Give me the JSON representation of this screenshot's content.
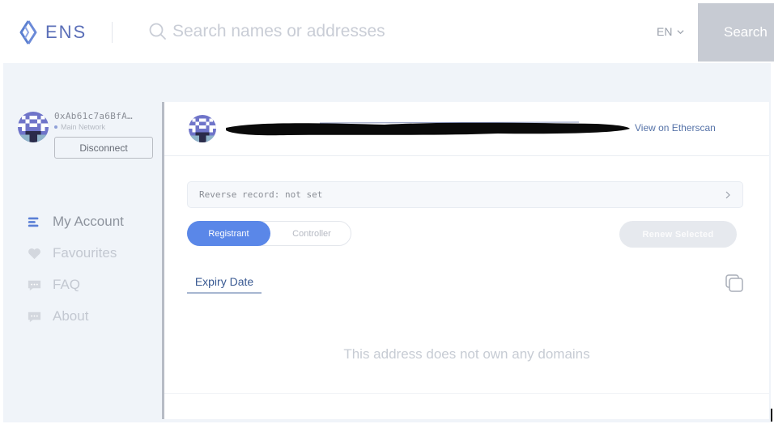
{
  "header": {
    "logo_text": "ENS",
    "search_placeholder": "Search names or addresses",
    "language": "EN",
    "search_button": "Search"
  },
  "account": {
    "address": "0xAb61c7a6BfA…",
    "network": "Main Network",
    "disconnect_label": "Disconnect"
  },
  "sidebar": {
    "items": [
      {
        "label": "My Account",
        "icon": "list-icon",
        "active": true
      },
      {
        "label": "Favourites",
        "icon": "heart-icon",
        "active": false
      },
      {
        "label": "FAQ",
        "icon": "chat-bubble-icon",
        "active": false
      },
      {
        "label": "About",
        "icon": "chat-bubble-icon",
        "active": false
      }
    ]
  },
  "main": {
    "etherscan_link": "View on Etherscan",
    "reverse_record": "Reverse record: not set",
    "tabs": [
      {
        "label": "Registrant",
        "selected": true
      },
      {
        "label": "Controller",
        "selected": false
      }
    ],
    "renew_button": "Renew Selected",
    "sort_label": "Expiry Date",
    "empty_message": "This address does not own any domains"
  },
  "colors": {
    "accent": "#5a87e8",
    "brand": "#5b6fb8",
    "background": "#f0f4f9"
  }
}
